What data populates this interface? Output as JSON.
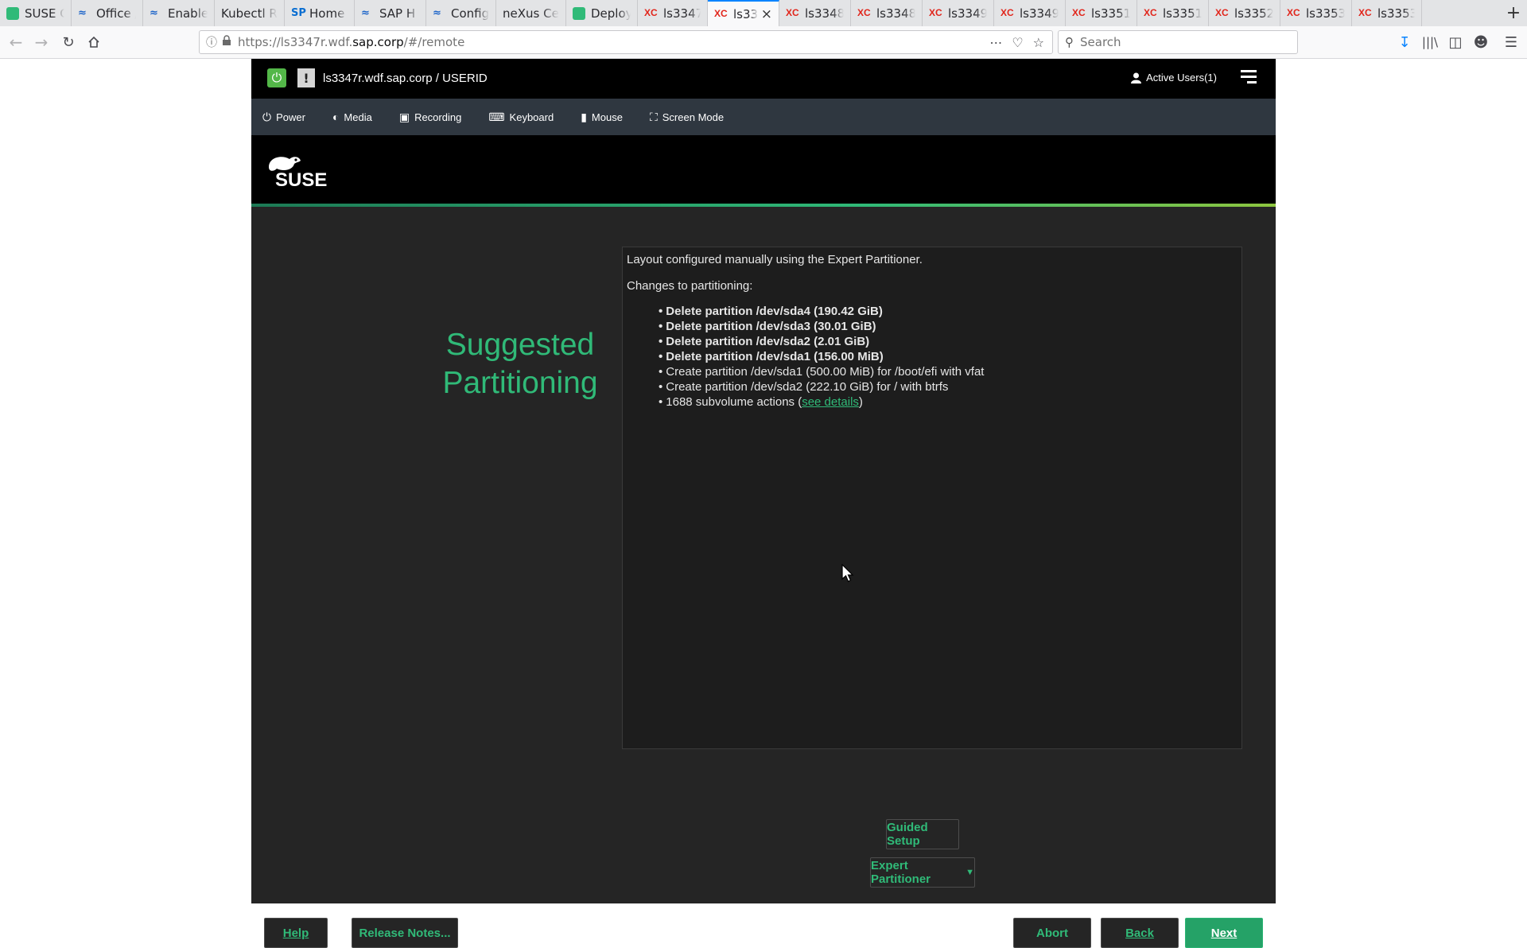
{
  "browser": {
    "tabs": [
      {
        "title": "SUSE C",
        "favicon": "suse-icon"
      },
      {
        "title": "Office /",
        "favicon": "sap-icon"
      },
      {
        "title": "Enable",
        "favicon": "sap-icon"
      },
      {
        "title": "Kubectl Re",
        "favicon": "none"
      },
      {
        "title": "Home -",
        "favicon": "sap-home-icon"
      },
      {
        "title": "SAP H",
        "favicon": "sap-icon"
      },
      {
        "title": "Config",
        "favicon": "sap-icon"
      },
      {
        "title": "neXus Cert",
        "favicon": "none"
      },
      {
        "title": "Deploy",
        "favicon": "suse-icon"
      },
      {
        "title": "ls3347",
        "favicon": "xc-icon"
      },
      {
        "title": "ls33",
        "favicon": "xc-icon",
        "active": true
      },
      {
        "title": "ls3348",
        "favicon": "xc-icon"
      },
      {
        "title": "ls3348",
        "favicon": "xc-icon"
      },
      {
        "title": "ls3349",
        "favicon": "xc-icon"
      },
      {
        "title": "ls3349",
        "favicon": "xc-icon"
      },
      {
        "title": "ls3351",
        "favicon": "xc-icon"
      },
      {
        "title": "ls3351",
        "favicon": "xc-icon"
      },
      {
        "title": "ls3352",
        "favicon": "xc-icon"
      },
      {
        "title": "ls3353",
        "favicon": "xc-icon"
      },
      {
        "title": "ls3353",
        "favicon": "xc-icon"
      }
    ],
    "url_prefix": "https://ls3347r.wdf.",
    "url_domain": "sap.corp",
    "url_suffix": "/#/remote",
    "search_placeholder": "Search"
  },
  "console": {
    "host": "ls3347r.wdf.sap.corp / USERID",
    "active_users": "Active Users(1)",
    "menu": [
      {
        "label": "Power",
        "icon": "power-icon"
      },
      {
        "label": "Media",
        "icon": "media-icon"
      },
      {
        "label": "Recording",
        "icon": "camera-icon"
      },
      {
        "label": "Keyboard",
        "icon": "keyboard-icon"
      },
      {
        "label": "Mouse",
        "icon": "mouse-icon"
      },
      {
        "label": "Screen Mode",
        "icon": "fullscreen-icon"
      }
    ]
  },
  "installer": {
    "logo_text": "SUSE",
    "title_line1": "Suggested",
    "title_line2": "Partitioning",
    "intro": "Layout configured manually using the Expert Partitioner.",
    "changes_heading": "Changes to partitioning:",
    "changes": [
      {
        "text": "Delete partition /dev/sda4 (190.42 GiB)",
        "bold": true
      },
      {
        "text": "Delete partition /dev/sda3 (30.01 GiB)",
        "bold": true
      },
      {
        "text": "Delete partition /dev/sda2 (2.01 GiB)",
        "bold": true
      },
      {
        "text": "Delete partition /dev/sda1 (156.00 MiB)",
        "bold": true
      },
      {
        "text": "Create partition /dev/sda1 (500.00 MiB) for /boot/efi with vfat",
        "bold": false
      },
      {
        "text": "Create partition /dev/sda2 (222.10 GiB) for / with btrfs",
        "bold": false
      }
    ],
    "subvolume_prefix": "1688 subvolume actions (",
    "subvolume_link": "see details",
    "subvolume_suffix": ")",
    "buttons": {
      "guided_setup": "Guided Setup",
      "expert_partitioner": "Expert Partitioner",
      "help": "Help",
      "release_notes": "Release Notes...",
      "abort": "Abort",
      "back": "Back",
      "next": "Next"
    }
  },
  "colors": {
    "suse_green": "#30ba78",
    "console_toolbar": "#2f3740",
    "installer_bg": "#252525",
    "browser_accent": "#0a84ff"
  }
}
